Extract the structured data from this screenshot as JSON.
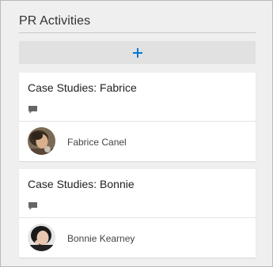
{
  "bucket": {
    "title": "PR Activities",
    "add_icon": "plus-icon",
    "accent_color": "#0078d4"
  },
  "cards": [
    {
      "title": "Case Studies: Fabrice",
      "comment_icon": "comment-icon",
      "assignee": "Fabrice Canel",
      "avatar_icon": "avatar-photo"
    },
    {
      "title": "Case Studies: Bonnie",
      "comment_icon": "comment-icon",
      "assignee": "Bonnie Kearney",
      "avatar_icon": "avatar-photo"
    }
  ]
}
